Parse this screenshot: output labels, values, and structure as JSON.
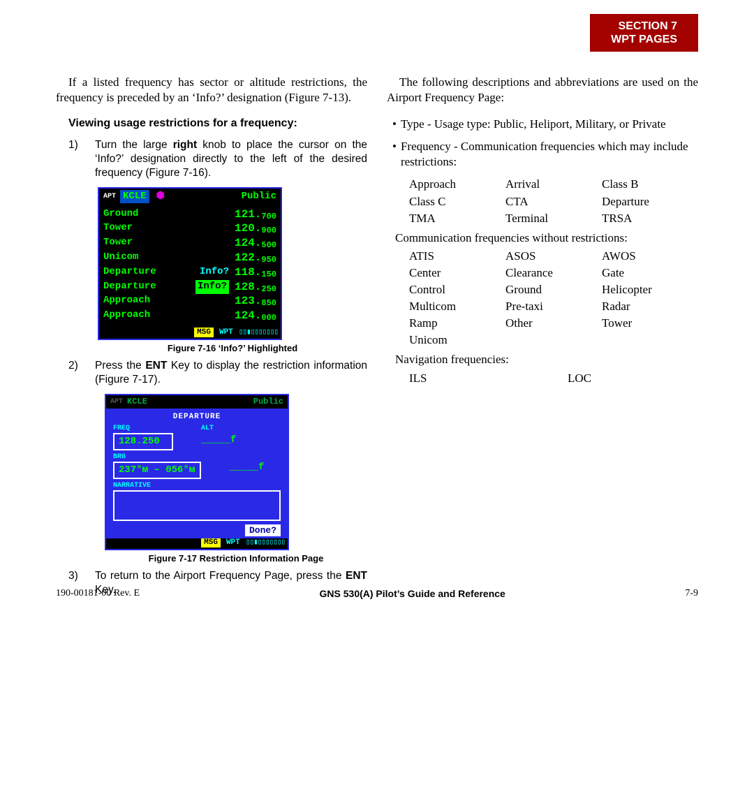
{
  "header": {
    "section": "SECTION 7",
    "title": "WPT PAGES"
  },
  "left": {
    "intro": "If a listed frequency has sector or altitude restrictions, the frequency is preceded by an ‘Info?’ designation (Figure 7-13).",
    "subhead": "Viewing usage restrictions for a frequency:",
    "step1_num": "1)",
    "step1_a": "Turn the large ",
    "step1_b": "right",
    "step1_c": " knob to place the cursor on the ‘Info?’ designation directly to the left of the desired frequency (Figure 7-16).",
    "step2_num": "2)",
    "step2_a": "Press the ",
    "step2_b": "ENT",
    "step2_c": " Key to display the restriction information (Figure 7-17).",
    "step3_num": "3)",
    "step3_a": "To return to the Airport Frequency Page, press the ",
    "step3_b": "ENT",
    "step3_c": " Key.",
    "fig1_caption": "Figure 7-16  ‘Info?’ Highlighted",
    "fig2_caption": "Figure 7-17  Restriction Information Page"
  },
  "gps1": {
    "apt_label": "APT",
    "apt_code": "KCLE",
    "facility": "Public",
    "rows": [
      {
        "name": "Ground",
        "info": "",
        "big": "121.",
        "small": "700"
      },
      {
        "name": "Tower",
        "info": "",
        "big": "120.",
        "small": "900"
      },
      {
        "name": "Tower",
        "info": "",
        "big": "124.",
        "small": "500"
      },
      {
        "name": "Unicom",
        "info": "",
        "big": "122.",
        "small": "950"
      },
      {
        "name": "Departure",
        "info": "Info?",
        "big": "118.",
        "small": "150"
      },
      {
        "name": "Departure",
        "info": "Info? ",
        "big": "128.",
        "small": "250",
        "hl": true
      },
      {
        "name": "Approach",
        "info": "",
        "big": "123.",
        "small": "850"
      },
      {
        "name": "Approach",
        "info": "",
        "big": "124.",
        "small": "000"
      }
    ],
    "msg": "MSG",
    "wpt": "WPT",
    "boxes": "▯▯▮▯▯▯▯▯▯▯"
  },
  "gps2": {
    "apt_label": "APT",
    "apt_code": "KCLE",
    "facility": "Public",
    "dep": "DEPARTURE",
    "freq_lbl": "FREQ",
    "freq_val": "128.250",
    "alt_lbl": "ALT",
    "alt_val1": "_____f",
    "alt_val2": "_____f",
    "brg_lbl": "BRG",
    "brg_val": "237°ᴍ – 056°ᴍ",
    "narr_lbl": "NARRATIVE",
    "done": "Done?",
    "msg": "MSG",
    "wpt": "WPT",
    "boxes": "▯▯▮▯▯▯▯▯▯▯"
  },
  "right": {
    "intro": "The following descriptions and abbreviations are used on the Airport Frequency Page:",
    "b1": "Type - Usage type: Public, Heliport, Military, or Private",
    "b2": "Frequency - Communication frequencies which may include restrictions:",
    "grid_a": [
      "Approach",
      "Arrival",
      "Class B",
      "Class C",
      "CTA",
      "Departure",
      "TMA",
      "Terminal",
      "TRSA"
    ],
    "sub2": "Communication frequencies without restrictions:",
    "grid_b": [
      "ATIS",
      "ASOS",
      "AWOS",
      "Center",
      "Clearance",
      "Gate",
      "Control",
      "Ground",
      "Helicopter",
      "Multicom",
      "Pre-taxi",
      "Radar",
      "Ramp",
      "Other",
      "Tower",
      "Unicom",
      "",
      ""
    ],
    "sub3": "Navigation frequencies:",
    "grid_c": [
      "ILS",
      "LOC"
    ]
  },
  "footer": {
    "rev": "190-00181-00  Rev. E",
    "title": "GNS 530(A) Pilot’s Guide and Reference",
    "page": "7-9"
  }
}
